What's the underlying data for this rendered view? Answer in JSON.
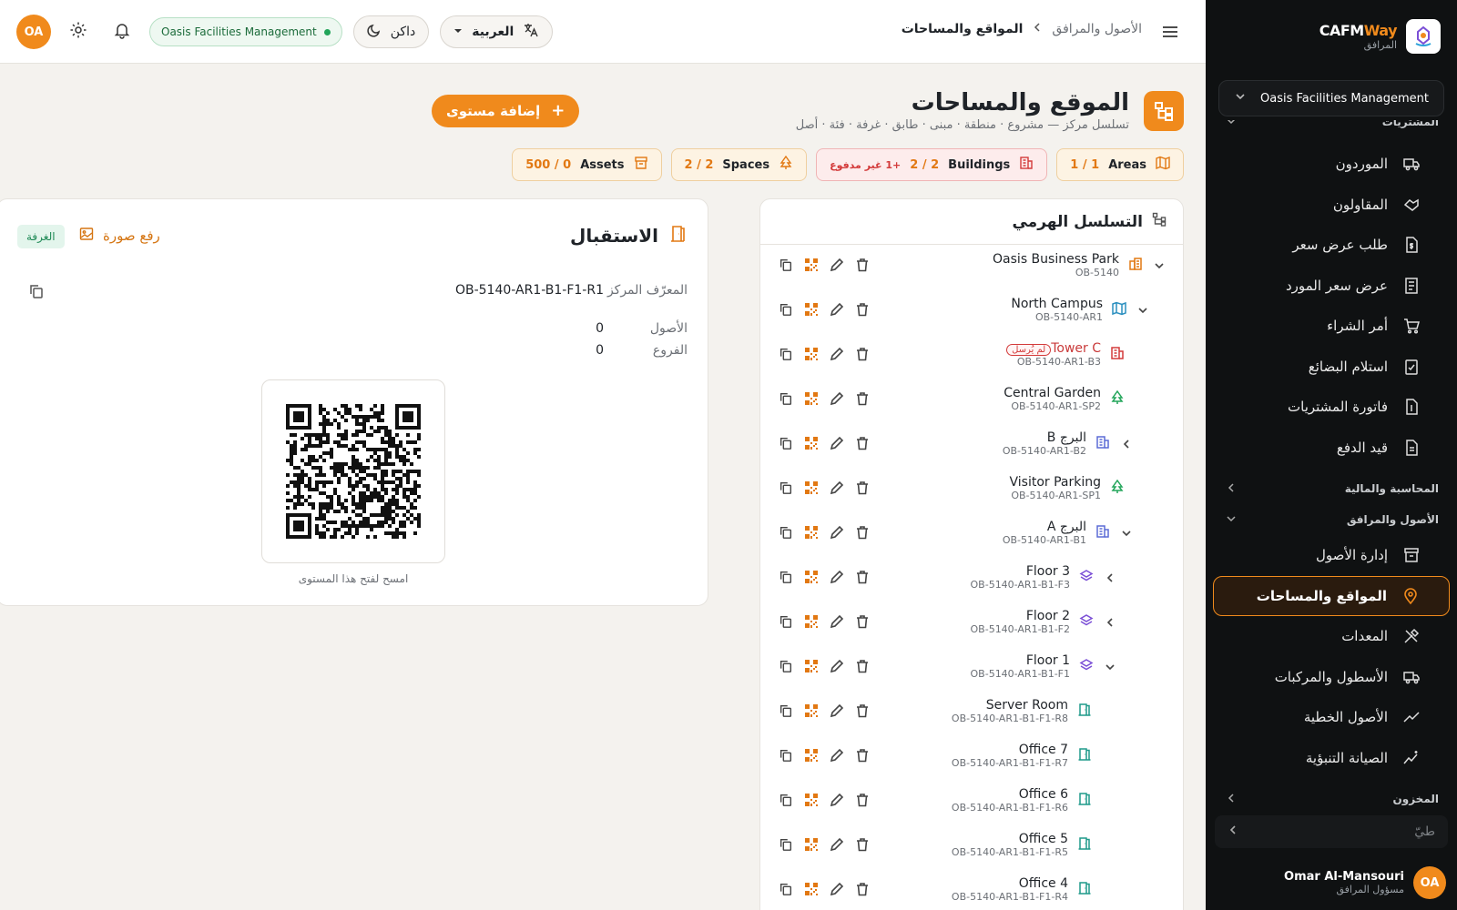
{
  "app": {
    "brand_main": "CAFM",
    "brand_accent": "Way",
    "brand_sub": "المرافق"
  },
  "org_select": "Oasis Facilities Management",
  "sidebar": {
    "sections": [
      {
        "label": "المشتريات",
        "items": [
          {
            "label": "الموردون",
            "icon": "truck-icon"
          },
          {
            "label": "المقاولون",
            "icon": "handshake-icon"
          },
          {
            "label": "طلب عرض سعر",
            "icon": "document-dollar-icon"
          },
          {
            "label": "عرض سعر المورد",
            "icon": "receipt-icon"
          },
          {
            "label": "أمر الشراء",
            "icon": "cart-icon"
          },
          {
            "label": "استلام البضائع",
            "icon": "clipboard-check-icon"
          },
          {
            "label": "فاتورة المشتريات",
            "icon": "invoice-icon"
          },
          {
            "label": "قيد الدفع",
            "icon": "payment-icon"
          }
        ]
      },
      {
        "label": "المحاسبة والمالية",
        "items": []
      },
      {
        "label": "الأصول والمرافق",
        "items": [
          {
            "label": "إدارة الأصول",
            "icon": "archive-icon"
          },
          {
            "label": "المواقع والمساحات",
            "icon": "map-pin-icon",
            "active": true
          },
          {
            "label": "المعدات",
            "icon": "tools-icon"
          },
          {
            "label": "الأسطول والمركبات",
            "icon": "fleet-truck-icon"
          },
          {
            "label": "الأصول الخطية",
            "icon": "line-chart-icon"
          },
          {
            "label": "الصيانة التنبؤية",
            "icon": "sparkline-icon"
          }
        ]
      },
      {
        "label": "المخزون",
        "items": []
      }
    ],
    "search_placeholder": "طيّ",
    "user": {
      "initials": "OA",
      "name": "Omar Al-Mansouri",
      "role": "مسؤول المرافق"
    }
  },
  "topbar": {
    "breadcrumb": [
      "الأصول والمرافق",
      "المواقع والمساحات"
    ],
    "language": "العربية",
    "theme": "داكن",
    "org_pill": "Oasis Facilities Management",
    "initials": "OA"
  },
  "page": {
    "title": "الموقع والمساحات",
    "subtitle": "تسلسل مركز — مشروع · منطقة · مبنى · طابق · غرفة · فئة · أصل",
    "add_level": "إضافة مستوى"
  },
  "stats": [
    {
      "value": "1 / 1",
      "label": "Areas"
    },
    {
      "value": "2 / 2",
      "label": "Buildings",
      "extra": "+1 غير مدفوع"
    },
    {
      "value": "2 / 2",
      "label": "Spaces"
    },
    {
      "value": "500 / 0",
      "label": "Assets"
    }
  ],
  "tree": {
    "title": "التسلسل الهرمي",
    "rows": [
      {
        "name": "Oasis Business Park",
        "code": "OB-5140",
        "type": "site",
        "caret": "down"
      },
      {
        "name": "North Campus",
        "code": "OB-5140-AR1",
        "type": "area",
        "caret": "down"
      },
      {
        "name": "Tower C",
        "code": "OB-5140-AR1-B3",
        "type": "building-red",
        "badge": "لم يُرسل"
      },
      {
        "name": "Central Garden",
        "code": "OB-5140-AR1-SP2",
        "type": "space"
      },
      {
        "name": "البرج B",
        "code": "OB-5140-AR1-B2",
        "type": "building",
        "caret": "left"
      },
      {
        "name": "Visitor Parking",
        "code": "OB-5140-AR1-SP1",
        "type": "space"
      },
      {
        "name": "البرج A",
        "code": "OB-5140-AR1-B1",
        "type": "building",
        "caret": "down"
      },
      {
        "name": "Floor 3",
        "code": "OB-5140-AR1-B1-F3",
        "type": "floor",
        "caret": "left"
      },
      {
        "name": "Floor 2",
        "code": "OB-5140-AR1-B1-F2",
        "type": "floor",
        "caret": "left"
      },
      {
        "name": "Floor 1",
        "code": "OB-5140-AR1-B1-F1",
        "type": "floor",
        "caret": "down"
      },
      {
        "name": "Server Room",
        "code": "OB-5140-AR1-B1-F1-R8",
        "type": "room"
      },
      {
        "name": "Office 7",
        "code": "OB-5140-AR1-B1-F1-R7",
        "type": "room"
      },
      {
        "name": "Office 6",
        "code": "OB-5140-AR1-B1-F1-R6",
        "type": "room"
      },
      {
        "name": "Office 5",
        "code": "OB-5140-AR1-B1-F1-R5",
        "type": "room"
      },
      {
        "name": "Office 4",
        "code": "OB-5140-AR1-B1-F1-R4",
        "type": "room"
      }
    ]
  },
  "detail": {
    "title": "الاستقبال",
    "upload_label": "رفع صورة",
    "type_tag": "الغرفة",
    "id_label": "المعرّف المركز",
    "id_value": "OB-5140-AR1-B1-F1-R1",
    "assets_label": "الأصول",
    "assets_value": "0",
    "children_label": "الفروع",
    "children_value": "0",
    "qr_caption": "امسح لفتح هذا المستوى"
  },
  "colors": {
    "accent": "#f08a1c",
    "sidebar_bg": "#0f1112",
    "page_bg": "#f4f2ee"
  }
}
